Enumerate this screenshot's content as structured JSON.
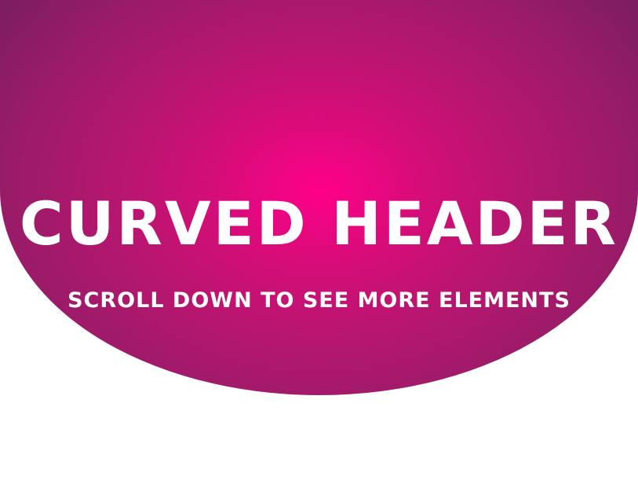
{
  "theme": {
    "background": "#ffffff",
    "header_gradient_center": "#ff0088",
    "header_gradient_edge": "#6f1f5c",
    "text": "#ffffff"
  },
  "header": {
    "title": "CURVED HEADER",
    "subtitle": "SCROLL DOWN TO SEE MORE ELEMENTS"
  }
}
